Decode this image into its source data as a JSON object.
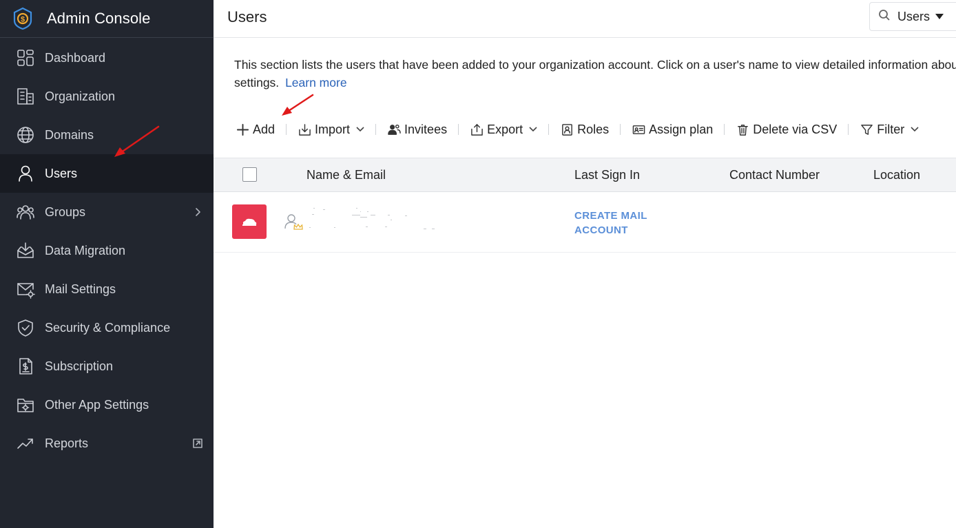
{
  "sidebar": {
    "title": "Admin Console",
    "items": [
      {
        "label": "Dashboard"
      },
      {
        "label": "Organization"
      },
      {
        "label": "Domains"
      },
      {
        "label": "Users"
      },
      {
        "label": "Groups"
      },
      {
        "label": "Data Migration"
      },
      {
        "label": "Mail Settings"
      },
      {
        "label": "Security & Compliance"
      },
      {
        "label": "Subscription"
      },
      {
        "label": "Other App Settings"
      },
      {
        "label": "Reports"
      }
    ],
    "active_item": "Users"
  },
  "header": {
    "title": "Users",
    "search_scope": "Users"
  },
  "main": {
    "description": "This section lists the users that have been added to your organization account. Click on a user's name to view detailed information about",
    "description_cont": "settings.",
    "learn_more": "Learn more",
    "toolbar": {
      "add": "Add",
      "import": "Import",
      "invitees": "Invitees",
      "export": "Export",
      "roles": "Roles",
      "assign_plan": "Assign plan",
      "delete_csv": "Delete via CSV",
      "filter": "Filter"
    },
    "table": {
      "columns": [
        "Name & Email",
        "Last Sign In",
        "Contact Number",
        "Location"
      ],
      "rows": [
        {
          "last_sign_in": "CREATE MAIL ACCOUNT"
        }
      ]
    }
  },
  "colors": {
    "sidebar_bg": "#22262f",
    "active_bg": "#181b22",
    "link": "#2b63b8",
    "avatar": "#e8374f",
    "annotation_arrow": "#e01a1a"
  }
}
